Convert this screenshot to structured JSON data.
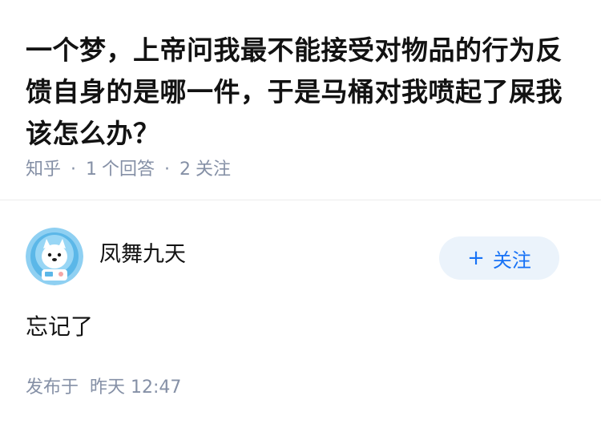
{
  "question": {
    "title": "一个梦，上帝问我最不能接受对物品的行为反馈自身的是哪一件，于是马桶对我喷起了屎我该怎么办？",
    "source": "知乎",
    "answer_count": "1",
    "answer_label": "个回答",
    "follow_count": "2",
    "follow_label": "关注",
    "separator": "·"
  },
  "answer": {
    "author_name": "凤舞九天",
    "avatar_icon": "astronaut-dog-avatar",
    "follow_button": {
      "plus": "+",
      "label": "关注"
    },
    "content": "忘记了",
    "published_prefix": "发布于",
    "published_time": "昨天 12:47"
  },
  "colors": {
    "text": "#121212",
    "muted": "#8590a6",
    "accent": "#1772f6",
    "button_bg": "#ebf3fb",
    "divider": "#ebebeb"
  }
}
